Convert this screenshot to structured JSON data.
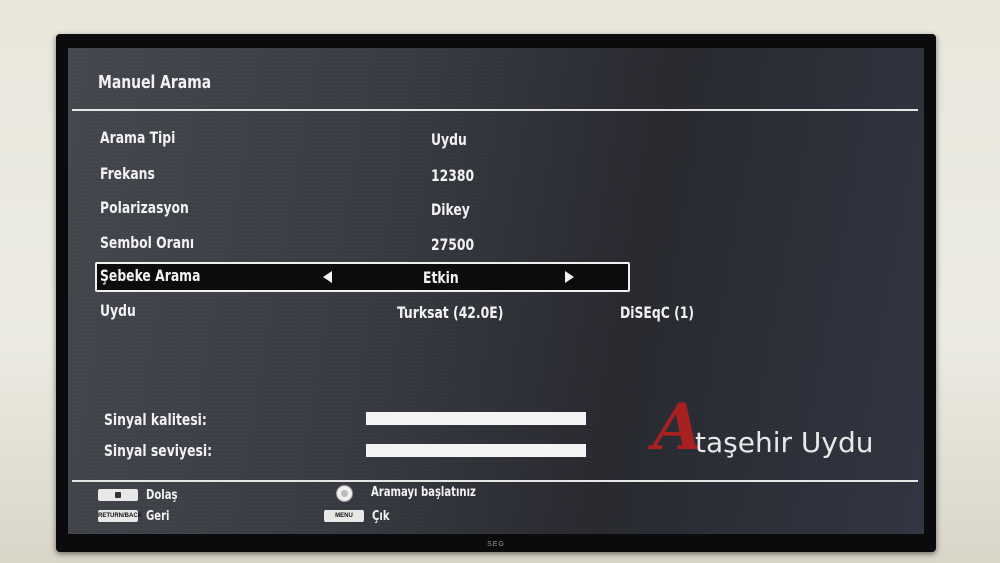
{
  "screen_title": "Manuel Arama",
  "rows": [
    {
      "label": "Arama Tipi",
      "value": "Uydu"
    },
    {
      "label": "Frekans",
      "value": "12380"
    },
    {
      "label": "Polarizasyon",
      "value": "Dikey"
    },
    {
      "label": "Sembol Oranı",
      "value": "27500"
    }
  ],
  "selected_row": {
    "label": "Şebeke Arama",
    "value": "Etkin"
  },
  "satellite_row": {
    "label": "Uydu",
    "value": "Turksat (42.0E)",
    "extra": "DiSEqC (1)"
  },
  "signal": {
    "quality_label": "Sinyal kalitesi:",
    "quality_level": 1.0,
    "level_label": "Sinyal seviyesi:",
    "level_level": 1.0
  },
  "footer": {
    "navigate_label": "Dolaş",
    "back_key": "RETURN/BACK",
    "back_label": "Geri",
    "ok_label": "Aramayı başlatınız",
    "menu_key": "MENU",
    "exit_label": "Çık"
  },
  "watermark": {
    "letter": "A",
    "text": "taşehir Uydu"
  },
  "brand": "SEG",
  "colors": {
    "watermark_red": "#b52020",
    "screen_bg": "#35373f",
    "text": "#f2f2f2"
  }
}
